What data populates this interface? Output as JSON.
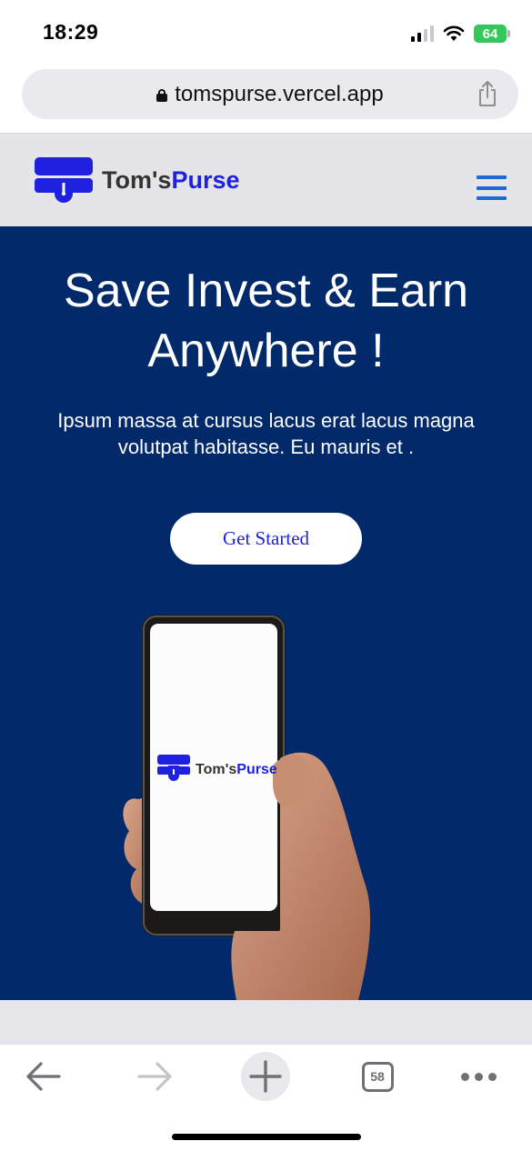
{
  "status_bar": {
    "time": "18:29",
    "battery": "64",
    "icons": [
      "signal-icon",
      "wifi-icon",
      "battery-icon"
    ]
  },
  "browser": {
    "url": "tomspurse.vercel.app",
    "tab_count": "58",
    "icons": [
      "lock-icon",
      "share-icon",
      "back-arrow-icon",
      "forward-arrow-icon",
      "plus-icon",
      "tabs-icon",
      "more-icon"
    ]
  },
  "header": {
    "logo_name": "Tom's",
    "logo_accent": "Purse"
  },
  "hero": {
    "title_line1": "Save Invest & Earn",
    "title_line2": "Anywhere !",
    "description": "Ipsum massa at cursus lacus erat lacus magna volutpat habitasse. Eu mauris et .",
    "cta_label": "Get Started",
    "phone_logo_name": "Tom's",
    "phone_logo_accent": "Purse"
  },
  "colors": {
    "hero_bg": "#022a6b",
    "brand": "#1e22e0",
    "menu": "#1f69d6",
    "header_bg": "#e5e5e7"
  }
}
